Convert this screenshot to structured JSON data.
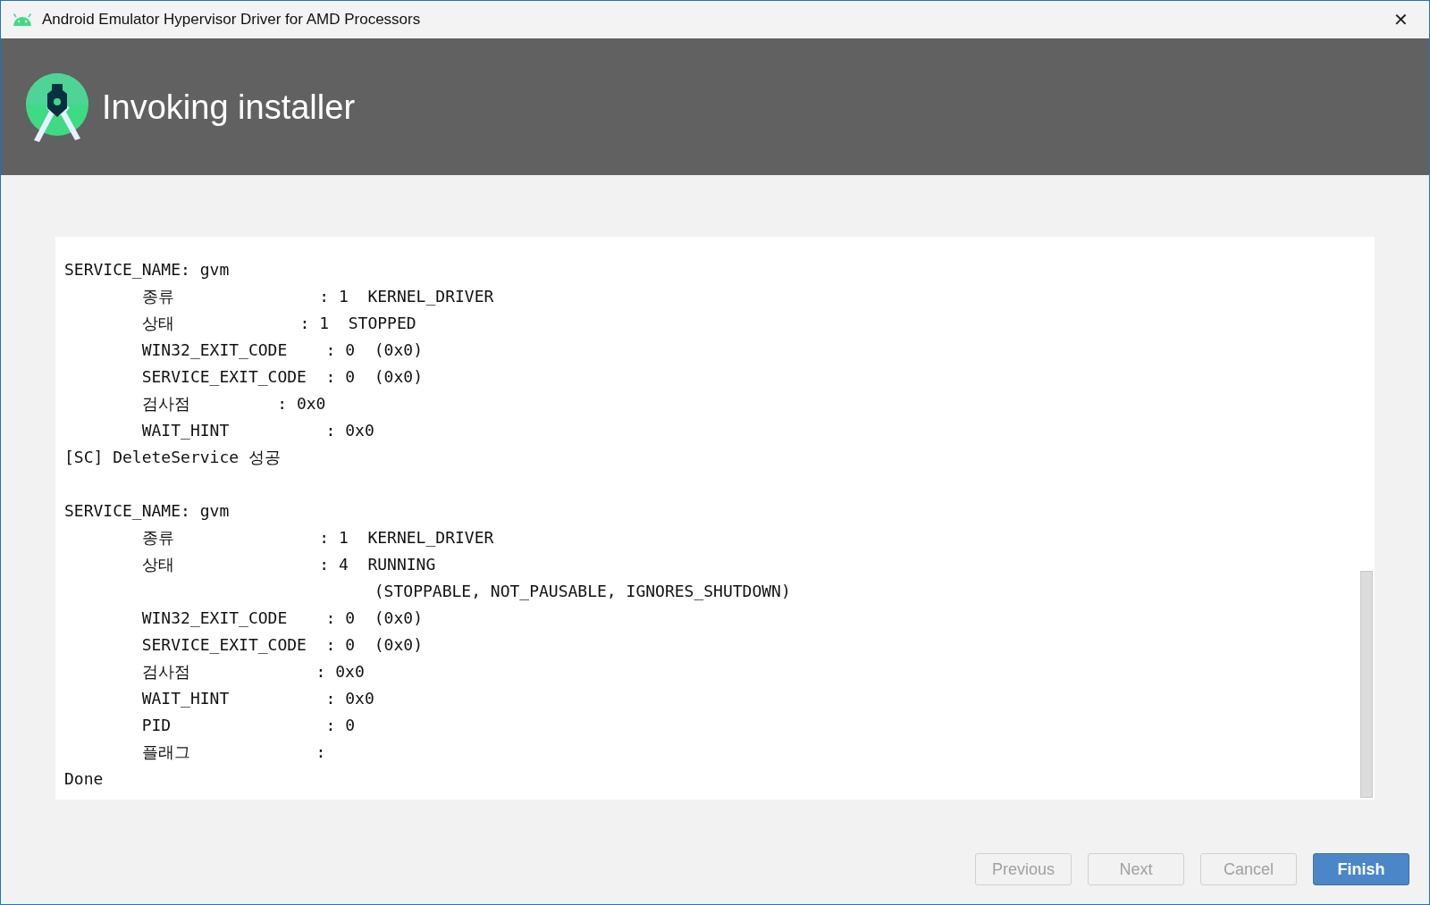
{
  "window": {
    "title": "Android Emulator Hypervisor Driver for AMD Processors",
    "close": "✕"
  },
  "header": {
    "title": "Invoking installer"
  },
  "log": {
    "blocks": [
      [
        "SERVICE_NAME: gvm",
        "        종류               : 1  KERNEL_DRIVER",
        "        상태             : 1  STOPPED",
        "        WIN32_EXIT_CODE    : 0  (0x0)",
        "        SERVICE_EXIT_CODE  : 0  (0x0)",
        "        검사점         : 0x0",
        "        WAIT_HINT          : 0x0",
        "[SC] DeleteService 성공"
      ],
      [
        "SERVICE_NAME: gvm",
        "        종류               : 1  KERNEL_DRIVER",
        "        상태               : 4  RUNNING",
        "                                (STOPPABLE, NOT_PAUSABLE, IGNORES_SHUTDOWN)",
        "        WIN32_EXIT_CODE    : 0  (0x0)",
        "        SERVICE_EXIT_CODE  : 0  (0x0)",
        "        검사점             : 0x0",
        "        WAIT_HINT          : 0x0",
        "        PID                : 0",
        "        플래그             :",
        "Done"
      ]
    ]
  },
  "buttons": [
    {
      "label": "Previous",
      "disabled": true,
      "default": false
    },
    {
      "label": "Next",
      "disabled": true,
      "default": false
    },
    {
      "label": "Cancel",
      "disabled": true,
      "default": false
    },
    {
      "label": "Finish",
      "disabled": false,
      "default": true
    }
  ]
}
